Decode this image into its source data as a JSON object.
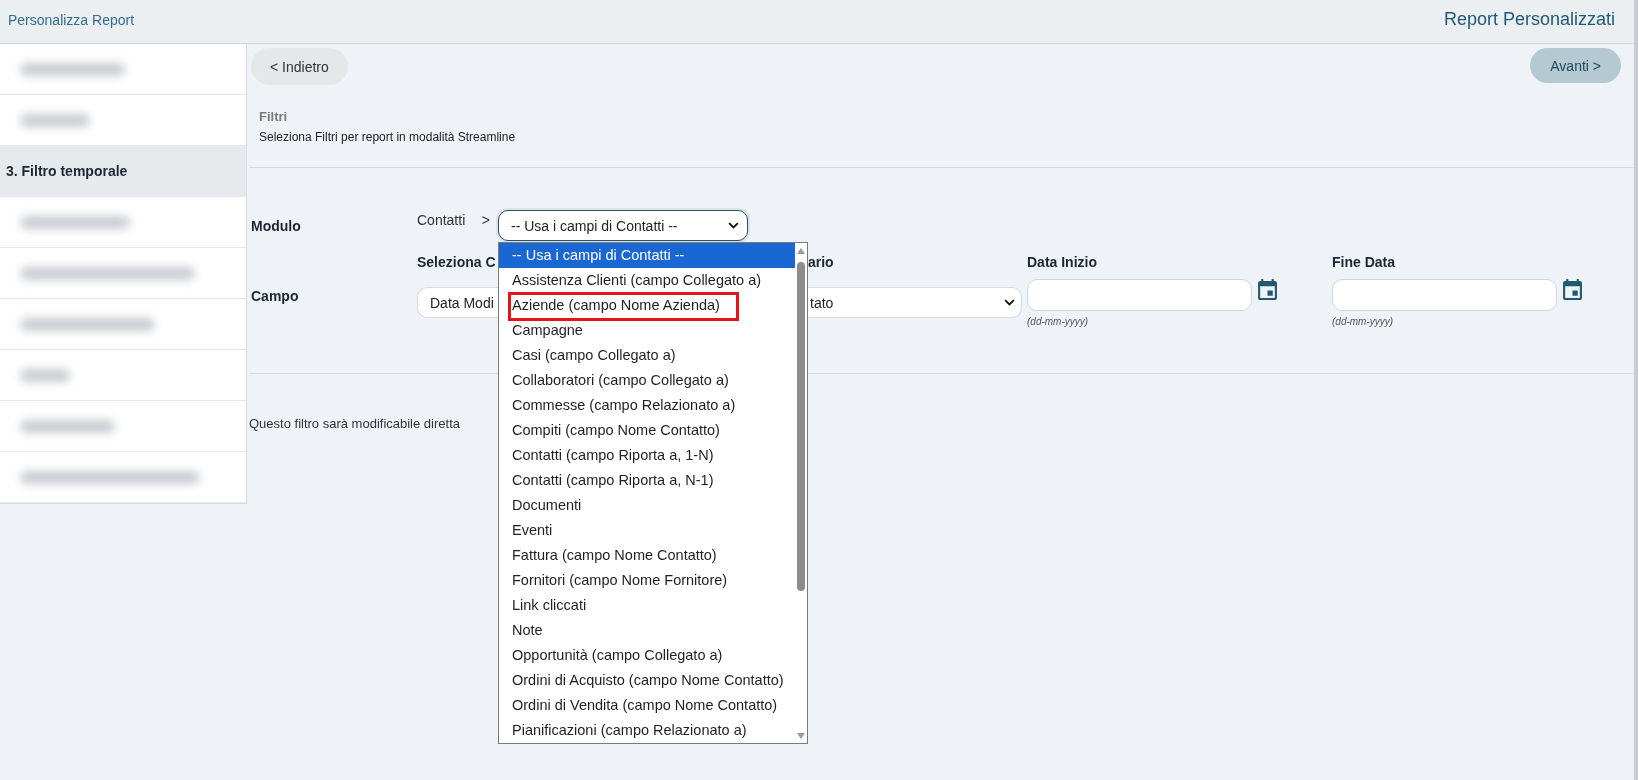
{
  "header": {
    "title": "Personalizza Report",
    "section_title": "Report Personalizzati"
  },
  "sidebar": {
    "items": [
      {
        "kind": "blurred",
        "selected": false
      },
      {
        "kind": "blurred",
        "selected": false
      },
      {
        "kind": "step",
        "label": "3. Filtro temporale",
        "selected": true
      },
      {
        "kind": "blurred",
        "selected": false
      },
      {
        "kind": "blurred",
        "selected": false
      },
      {
        "kind": "blurred",
        "selected": false
      },
      {
        "kind": "blurred",
        "selected": false
      },
      {
        "kind": "blurred",
        "selected": false
      },
      {
        "kind": "blurred",
        "selected": false
      }
    ]
  },
  "nav": {
    "back_button": "< Indietro",
    "next_button": "Avanti >"
  },
  "section": {
    "title": "Filtri",
    "description": "Seleziona Filtri per report in modalità Streamline"
  },
  "form": {
    "modulo": {
      "label": "Modulo",
      "module": "Contatti",
      "separator": ">",
      "select": {
        "value": "-- Usa i campi di Contatti --",
        "expanded": true,
        "options": [
          {
            "label": "-- Usa i campi di Contatti --",
            "selected": true,
            "outlined": false
          },
          {
            "label": "Assistenza Clienti (campo Collegato a)",
            "selected": false,
            "outlined": false
          },
          {
            "label": "Aziende (campo Nome Azienda)",
            "selected": false,
            "outlined": true
          },
          {
            "label": "Campagne",
            "selected": false,
            "outlined": false
          },
          {
            "label": "Casi (campo Collegato a)",
            "selected": false,
            "outlined": false
          },
          {
            "label": "Collaboratori (campo Collegato a)",
            "selected": false,
            "outlined": false
          },
          {
            "label": "Commesse (campo Relazionato a)",
            "selected": false,
            "outlined": false
          },
          {
            "label": "Compiti (campo Nome Contatto)",
            "selected": false,
            "outlined": false
          },
          {
            "label": "Contatti (campo Riporta a, 1-N)",
            "selected": false,
            "outlined": false
          },
          {
            "label": "Contatti (campo Riporta a, N-1)",
            "selected": false,
            "outlined": false
          },
          {
            "label": "Documenti",
            "selected": false,
            "outlined": false
          },
          {
            "label": "Eventi",
            "selected": false,
            "outlined": false
          },
          {
            "label": "Fattura (campo Nome Contatto)",
            "selected": false,
            "outlined": false
          },
          {
            "label": "Fornitori (campo Nome Fornitore)",
            "selected": false,
            "outlined": false
          },
          {
            "label": "Link cliccati",
            "selected": false,
            "outlined": false
          },
          {
            "label": "Note",
            "selected": false,
            "outlined": false
          },
          {
            "label": "Opportunità (campo Collegato a)",
            "selected": false,
            "outlined": false
          },
          {
            "label": "Ordini di Acquisto (campo Nome Contatto)",
            "selected": false,
            "outlined": false
          },
          {
            "label": "Ordini di Vendita (campo Nome Contatto)",
            "selected": false,
            "outlined": false
          },
          {
            "label": "Pianificazioni (campo Relazionato a)",
            "selected": false,
            "outlined": false
          }
        ]
      }
    },
    "campo": {
      "label": "Campo",
      "field_heading": "Seleziona C",
      "field_value": "Data Modi",
      "range_heading": "ario",
      "range_value": "tato",
      "dates": [
        {
          "heading": "Data Inizio",
          "hint": "(dd-mm-yyyy)"
        },
        {
          "heading": "Fine Data",
          "hint": "(dd-mm-yyyy)"
        }
      ]
    }
  },
  "note": "Questo filtro sarà modificabile diretta"
}
